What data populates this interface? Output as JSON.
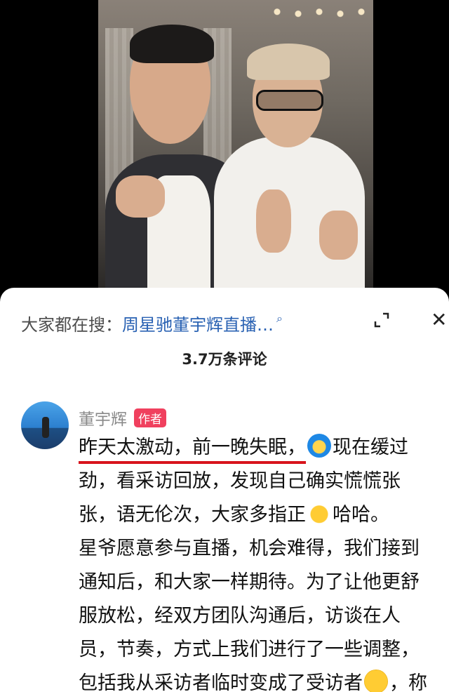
{
  "search": {
    "prefix": "大家都在搜：",
    "term": "周星驰董宇辉直播…"
  },
  "icons": {
    "search": "search-icon",
    "expand": "expand-icon",
    "close": "close-icon"
  },
  "comments_header": {
    "count": "3.7万条评论"
  },
  "comment": {
    "author": "董宇辉",
    "badge": "作者",
    "badge_color": "#f0405e",
    "lines": [
      {
        "underlined": "昨天太激动，前一晚失眠，",
        "after": "现在缓过"
      },
      {
        "text": "劲，看采访回放，发现自己确实慌慌张"
      },
      {
        "before": "张，语无伦次，大家多指正",
        "after": "哈哈。"
      },
      {
        "text": "星爷愿意参与直播，机会难得，我们接到"
      },
      {
        "text": "通知后，和大家一样期待。为了让他更舒"
      },
      {
        "text": "服放松，经双方团队沟通后，访谈在人"
      },
      {
        "text": "员，节奏，方式上我们进行了一些调整，"
      },
      {
        "before": "包括我从采访者临时变成了受访者",
        "after": "，称"
      }
    ],
    "emojis": [
      "blue-hair-emoji",
      "folded-hands-emoji",
      "grinning-emoji"
    ]
  },
  "colors": {
    "link": "#2a62b3",
    "underline": "#d8141c"
  }
}
